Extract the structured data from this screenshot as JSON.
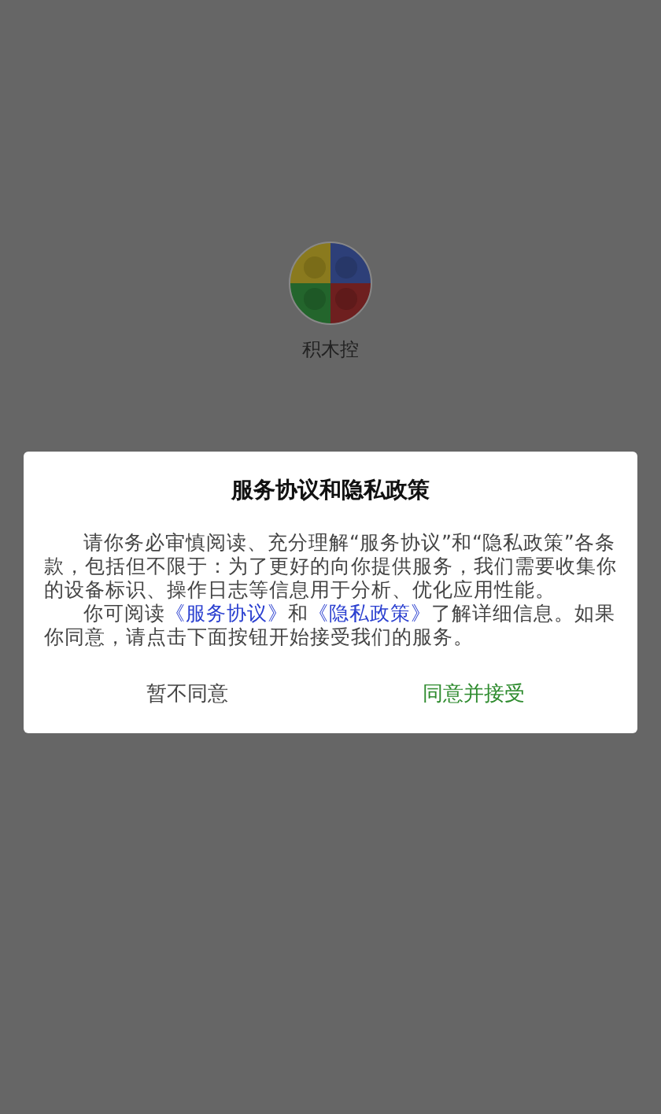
{
  "app": {
    "name": "积木控"
  },
  "dialog": {
    "title": "服务协议和隐私政策",
    "paragraphs": [
      {
        "parts": [
          {
            "kind": "text",
            "text": "请你务必审慎阅读、充分理解“服务协议”和“隐私政策”各条款，包括但不限于：为了更好的向你提供服务，我们需要收集你的设备标识、操作日志等信息用于分析、优化应用性能。"
          }
        ]
      },
      {
        "parts": [
          {
            "kind": "text",
            "text": "你可阅读"
          },
          {
            "kind": "link",
            "text": "《服务协议》"
          },
          {
            "kind": "text",
            "text": "和"
          },
          {
            "kind": "link",
            "text": "《隐私政策》"
          },
          {
            "kind": "text",
            "text": "了解详细信息。如果你同意，请点击下面按钮开始接受我们的服务。"
          }
        ]
      }
    ],
    "buttons": [
      {
        "label": "暂不同意",
        "kind": "decline"
      },
      {
        "label": "同意并接受",
        "kind": "accept"
      }
    ]
  }
}
